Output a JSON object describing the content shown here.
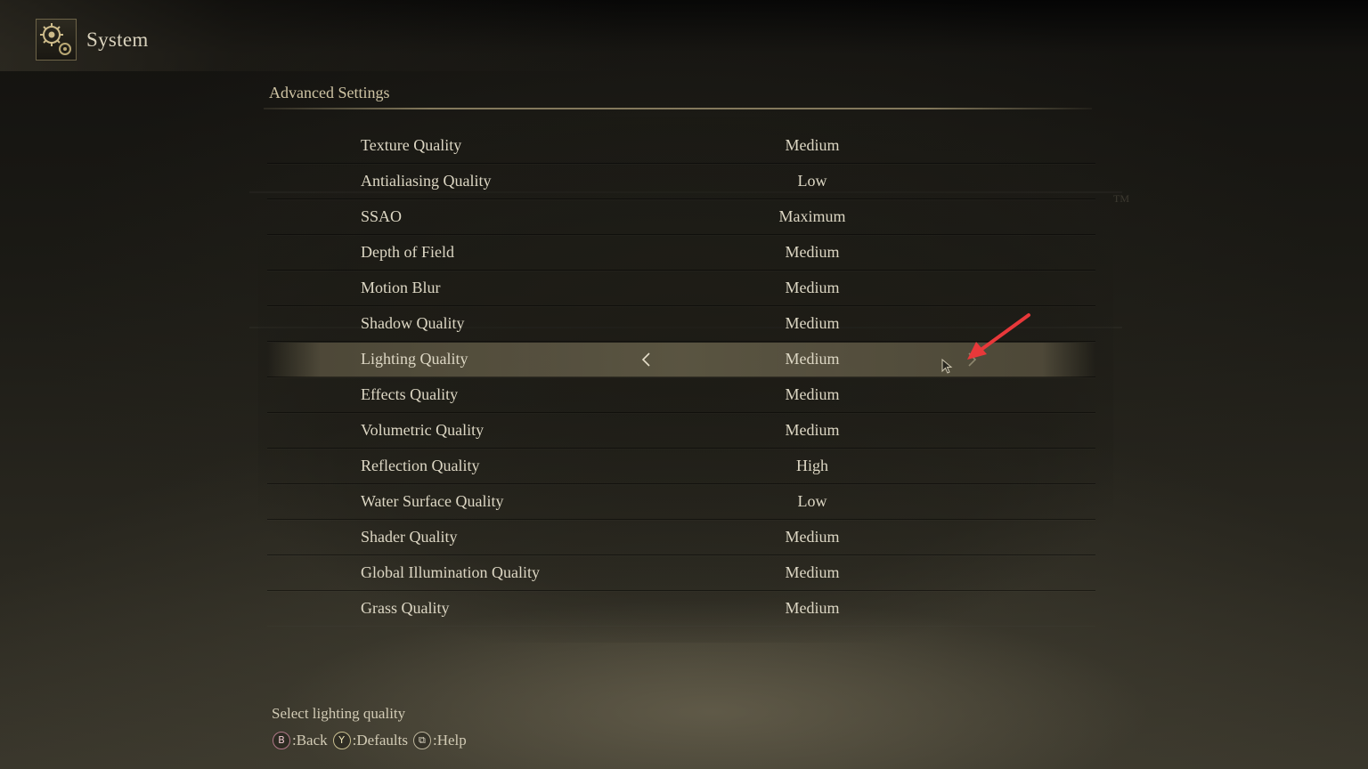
{
  "header": {
    "title": "System",
    "icon": "gear-icon"
  },
  "watermark": {
    "tm": "TM"
  },
  "section": {
    "title": "Advanced Settings"
  },
  "settings": [
    {
      "label": "Texture Quality",
      "value": "Medium"
    },
    {
      "label": "Antialiasing Quality",
      "value": "Low"
    },
    {
      "label": "SSAO",
      "value": "Maximum"
    },
    {
      "label": "Depth of Field",
      "value": "Medium"
    },
    {
      "label": "Motion Blur",
      "value": "Medium"
    },
    {
      "label": "Shadow Quality",
      "value": "Medium"
    },
    {
      "label": "Lighting Quality",
      "value": "Medium",
      "selected": true
    },
    {
      "label": "Effects Quality",
      "value": "Medium"
    },
    {
      "label": "Volumetric Quality",
      "value": "Medium"
    },
    {
      "label": "Reflection Quality",
      "value": "High"
    },
    {
      "label": "Water Surface Quality",
      "value": "Low"
    },
    {
      "label": "Shader Quality",
      "value": "Medium"
    },
    {
      "label": "Global Illumination Quality",
      "value": "Medium"
    },
    {
      "label": "Grass Quality",
      "value": "Medium"
    }
  ],
  "footer": {
    "help_text": "Select lighting quality",
    "controls": [
      {
        "glyph": "B",
        "label": ":Back"
      },
      {
        "glyph": "Y",
        "label": ":Defaults"
      },
      {
        "glyph": "⧉",
        "label": ":Help"
      }
    ]
  },
  "colors": {
    "text": "#ddd7c4",
    "accent_gold": "#cfc4a4",
    "annotation_red": "#e8383a"
  }
}
